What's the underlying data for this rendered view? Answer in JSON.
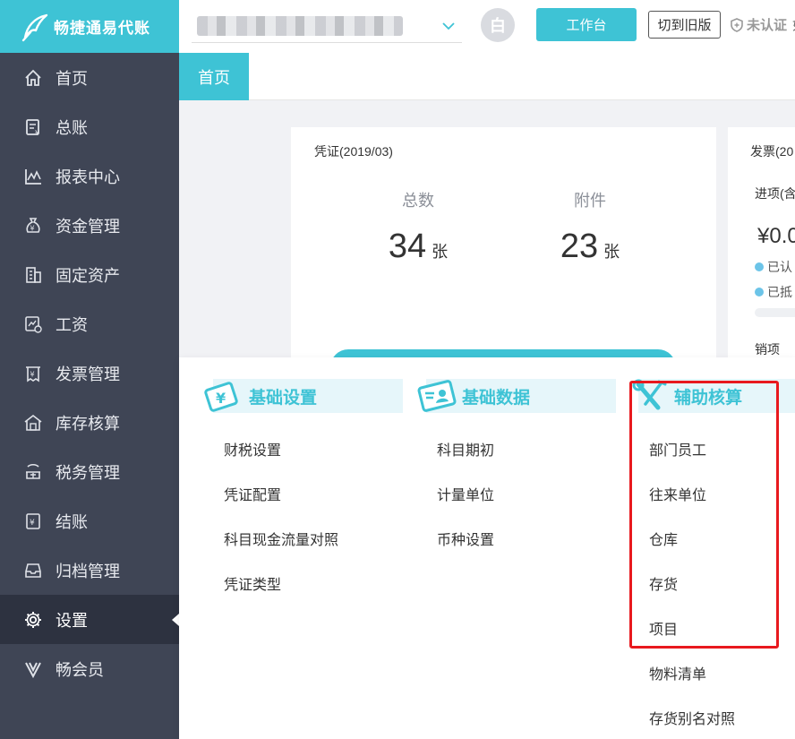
{
  "app": {
    "logo_text": "畅捷通易代账",
    "brand_color": "#3ec3d5",
    "sidebar_bg": "#3f4555"
  },
  "sidebar": {
    "items": [
      {
        "label": "首页",
        "icon": "home-icon"
      },
      {
        "label": "总账",
        "icon": "ledger-icon"
      },
      {
        "label": "报表中心",
        "icon": "chart-icon"
      },
      {
        "label": "资金管理",
        "icon": "money-bag-icon"
      },
      {
        "label": "固定资产",
        "icon": "building-icon"
      },
      {
        "label": "工资",
        "icon": "salary-icon"
      },
      {
        "label": "发票管理",
        "icon": "invoice-icon"
      },
      {
        "label": "库存核算",
        "icon": "warehouse-icon"
      },
      {
        "label": "税务管理",
        "icon": "tax-icon"
      },
      {
        "label": "结账",
        "icon": "checkout-icon"
      },
      {
        "label": "归档管理",
        "icon": "archive-icon"
      },
      {
        "label": "设置",
        "icon": "gear-icon",
        "active": true
      },
      {
        "label": "畅会员",
        "icon": "vip-icon"
      }
    ]
  },
  "header": {
    "circle_label": "白",
    "workbench_button": "工作台",
    "old_version_button": "切到旧版",
    "cert_status": "未认证",
    "cert_extra": "如"
  },
  "tabs": [
    {
      "label": "首页"
    }
  ],
  "voucher_card": {
    "title": "凭证(2019/03)",
    "total_label": "总数",
    "total_value": "34",
    "total_unit": "张",
    "attach_label": "附件",
    "attach_value": "23",
    "attach_unit": "张"
  },
  "invoice_card": {
    "title": "发票(20",
    "in_label": "进项(含",
    "amount": "¥0.0",
    "row1": "已认",
    "row2": "已抵",
    "out_label": "销项"
  },
  "menu": {
    "columns": [
      {
        "title": "基础设置",
        "icon": "tax-settings-icon",
        "items": [
          "财税设置",
          "凭证配置",
          "科目现金流量对照",
          "凭证类型"
        ]
      },
      {
        "title": "基础数据",
        "icon": "data-card-icon",
        "items": [
          "科目期初",
          "计量单位",
          "币种设置"
        ]
      },
      {
        "title": "辅助核算",
        "icon": "tools-icon",
        "items": [
          "部门员工",
          "往来单位",
          "仓库",
          "存货",
          "项目",
          "物料清单",
          "存货别名对照"
        ]
      }
    ]
  }
}
